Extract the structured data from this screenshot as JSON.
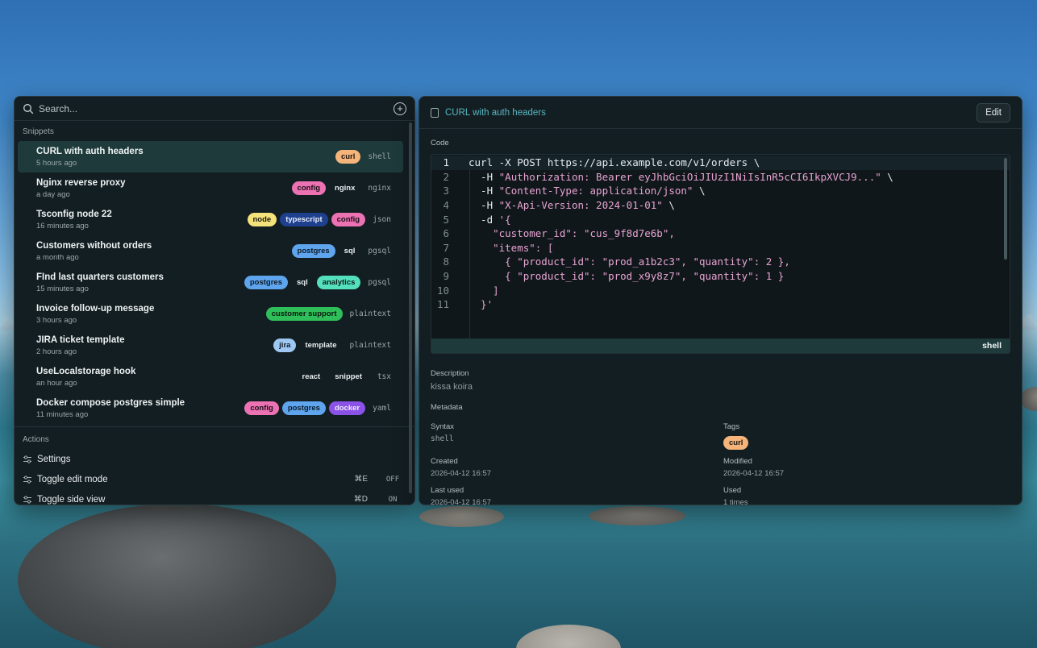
{
  "search": {
    "placeholder": "Search..."
  },
  "sections": {
    "snippets": "Snippets",
    "actions": "Actions"
  },
  "snippets": [
    {
      "title": "CURL with auth headers",
      "time": "5 hours ago",
      "syntax": "shell",
      "active": true,
      "tags": [
        {
          "label": "curl",
          "bg": "#f5b47a",
          "fg": "#1b1410"
        }
      ]
    },
    {
      "title": "Nginx reverse proxy",
      "time": "a day ago",
      "syntax": "nginx",
      "tags": [
        {
          "label": "config",
          "bg": "#ec72b3",
          "fg": "#1b0f17"
        },
        {
          "label": "nginx",
          "bg": "transparent",
          "fg": "#e7edef"
        }
      ]
    },
    {
      "title": "Tsconfig node 22",
      "time": "16 minutes ago",
      "syntax": "json",
      "tags": [
        {
          "label": "node",
          "bg": "#f4e27a",
          "fg": "#1b1a0f"
        },
        {
          "label": "typescript",
          "bg": "#1f3f8f",
          "fg": "#e8eefb"
        },
        {
          "label": "config",
          "bg": "#ec72b3",
          "fg": "#1b0f17"
        }
      ]
    },
    {
      "title": "Customers without orders",
      "time": "a month ago",
      "syntax": "pgsql",
      "tags": [
        {
          "label": "postgres",
          "bg": "#5ea5ee",
          "fg": "#0d1a26"
        },
        {
          "label": "sql",
          "bg": "transparent",
          "fg": "#e7edef"
        }
      ]
    },
    {
      "title": "FInd last quarters customers",
      "time": "15 minutes ago",
      "syntax": "pgsql",
      "tags": [
        {
          "label": "postgres",
          "bg": "#5ea5ee",
          "fg": "#0d1a26"
        },
        {
          "label": "sql",
          "bg": "transparent",
          "fg": "#e7edef"
        },
        {
          "label": "analytics",
          "bg": "#54dfbd",
          "fg": "#0c1f1a"
        }
      ]
    },
    {
      "title": "Invoice follow-up message",
      "time": "3 hours ago",
      "syntax": "plaintext",
      "tags": [
        {
          "label": "customer support",
          "bg": "#2fbf5a",
          "fg": "#0b1a0f"
        }
      ]
    },
    {
      "title": "JIRA ticket template",
      "time": "2 hours ago",
      "syntax": "plaintext",
      "tags": [
        {
          "label": "jira",
          "bg": "#9ec8f2",
          "fg": "#0f1a26"
        },
        {
          "label": "template",
          "bg": "transparent",
          "fg": "#e7edef"
        }
      ]
    },
    {
      "title": "UseLocalstorage hook",
      "time": "an hour ago",
      "syntax": "tsx",
      "tags": [
        {
          "label": "react",
          "bg": "transparent",
          "fg": "#e7edef"
        },
        {
          "label": "snippet",
          "bg": "transparent",
          "fg": "#e7edef"
        }
      ]
    },
    {
      "title": "Docker compose postgres simple",
      "time": "11 minutes ago",
      "syntax": "yaml",
      "tags": [
        {
          "label": "config",
          "bg": "#ec72b3",
          "fg": "#1b0f17"
        },
        {
          "label": "postgres",
          "bg": "#5ea5ee",
          "fg": "#0d1a26"
        },
        {
          "label": "docker",
          "bg": "#8a52e6",
          "fg": "#f1eafc"
        }
      ]
    }
  ],
  "actions": [
    {
      "label": "Settings",
      "shortcut": "",
      "state": ""
    },
    {
      "label": "Toggle edit mode",
      "shortcut": "⌘E",
      "state": "OFF"
    },
    {
      "label": "Toggle side view",
      "shortcut": "⌘D",
      "state": "ON"
    }
  ],
  "detail": {
    "title": "CURL with auth headers",
    "edit_label": "Edit",
    "code_label": "Code",
    "syntax_footer": "shell",
    "code": [
      [
        [
          "k",
          "curl -X POST https://api.example.com/v1/orders \\"
        ]
      ],
      [
        [
          "k",
          "  -H "
        ],
        [
          "s",
          "\"Authorization: Bearer eyJhbGciOiJIUzI1NiIsInR5cCI6IkpXVCJ9...\""
        ],
        [
          "k",
          " \\"
        ]
      ],
      [
        [
          "k",
          "  -H "
        ],
        [
          "s",
          "\"Content-Type: application/json\""
        ],
        [
          "k",
          " \\"
        ]
      ],
      [
        [
          "k",
          "  -H "
        ],
        [
          "s",
          "\"X-Api-Version: 2024-01-01\""
        ],
        [
          "k",
          " \\"
        ]
      ],
      [
        [
          "k",
          "  -d "
        ],
        [
          "s",
          "'{"
        ]
      ],
      [
        [
          "s",
          "    \"customer_id\": \"cus_9f8d7e6b\","
        ]
      ],
      [
        [
          "s",
          "    \"items\": ["
        ]
      ],
      [
        [
          "s",
          "      { \"product_id\": \"prod_a1b2c3\", \"quantity\": 2 },"
        ]
      ],
      [
        [
          "s",
          "      { \"product_id\": \"prod_x9y8z7\", \"quantity\": 1 }"
        ]
      ],
      [
        [
          "s",
          "    ]"
        ]
      ],
      [
        [
          "s",
          "  }'"
        ]
      ]
    ],
    "description_label": "Description",
    "description": "kissa koira",
    "metadata_label": "Metadata",
    "meta": {
      "syntax_label": "Syntax",
      "syntax": "shell",
      "tags_label": "Tags",
      "tag": "curl",
      "tag_color": "#f5b47a",
      "created_label": "Created",
      "created": "2026-04-12 16:57",
      "modified_label": "Modified",
      "modified": "2026-04-12 16:57",
      "last_used_label": "Last used",
      "last_used": "2026-04-12 16:57",
      "used_label": "Used",
      "used": "1 times"
    }
  }
}
